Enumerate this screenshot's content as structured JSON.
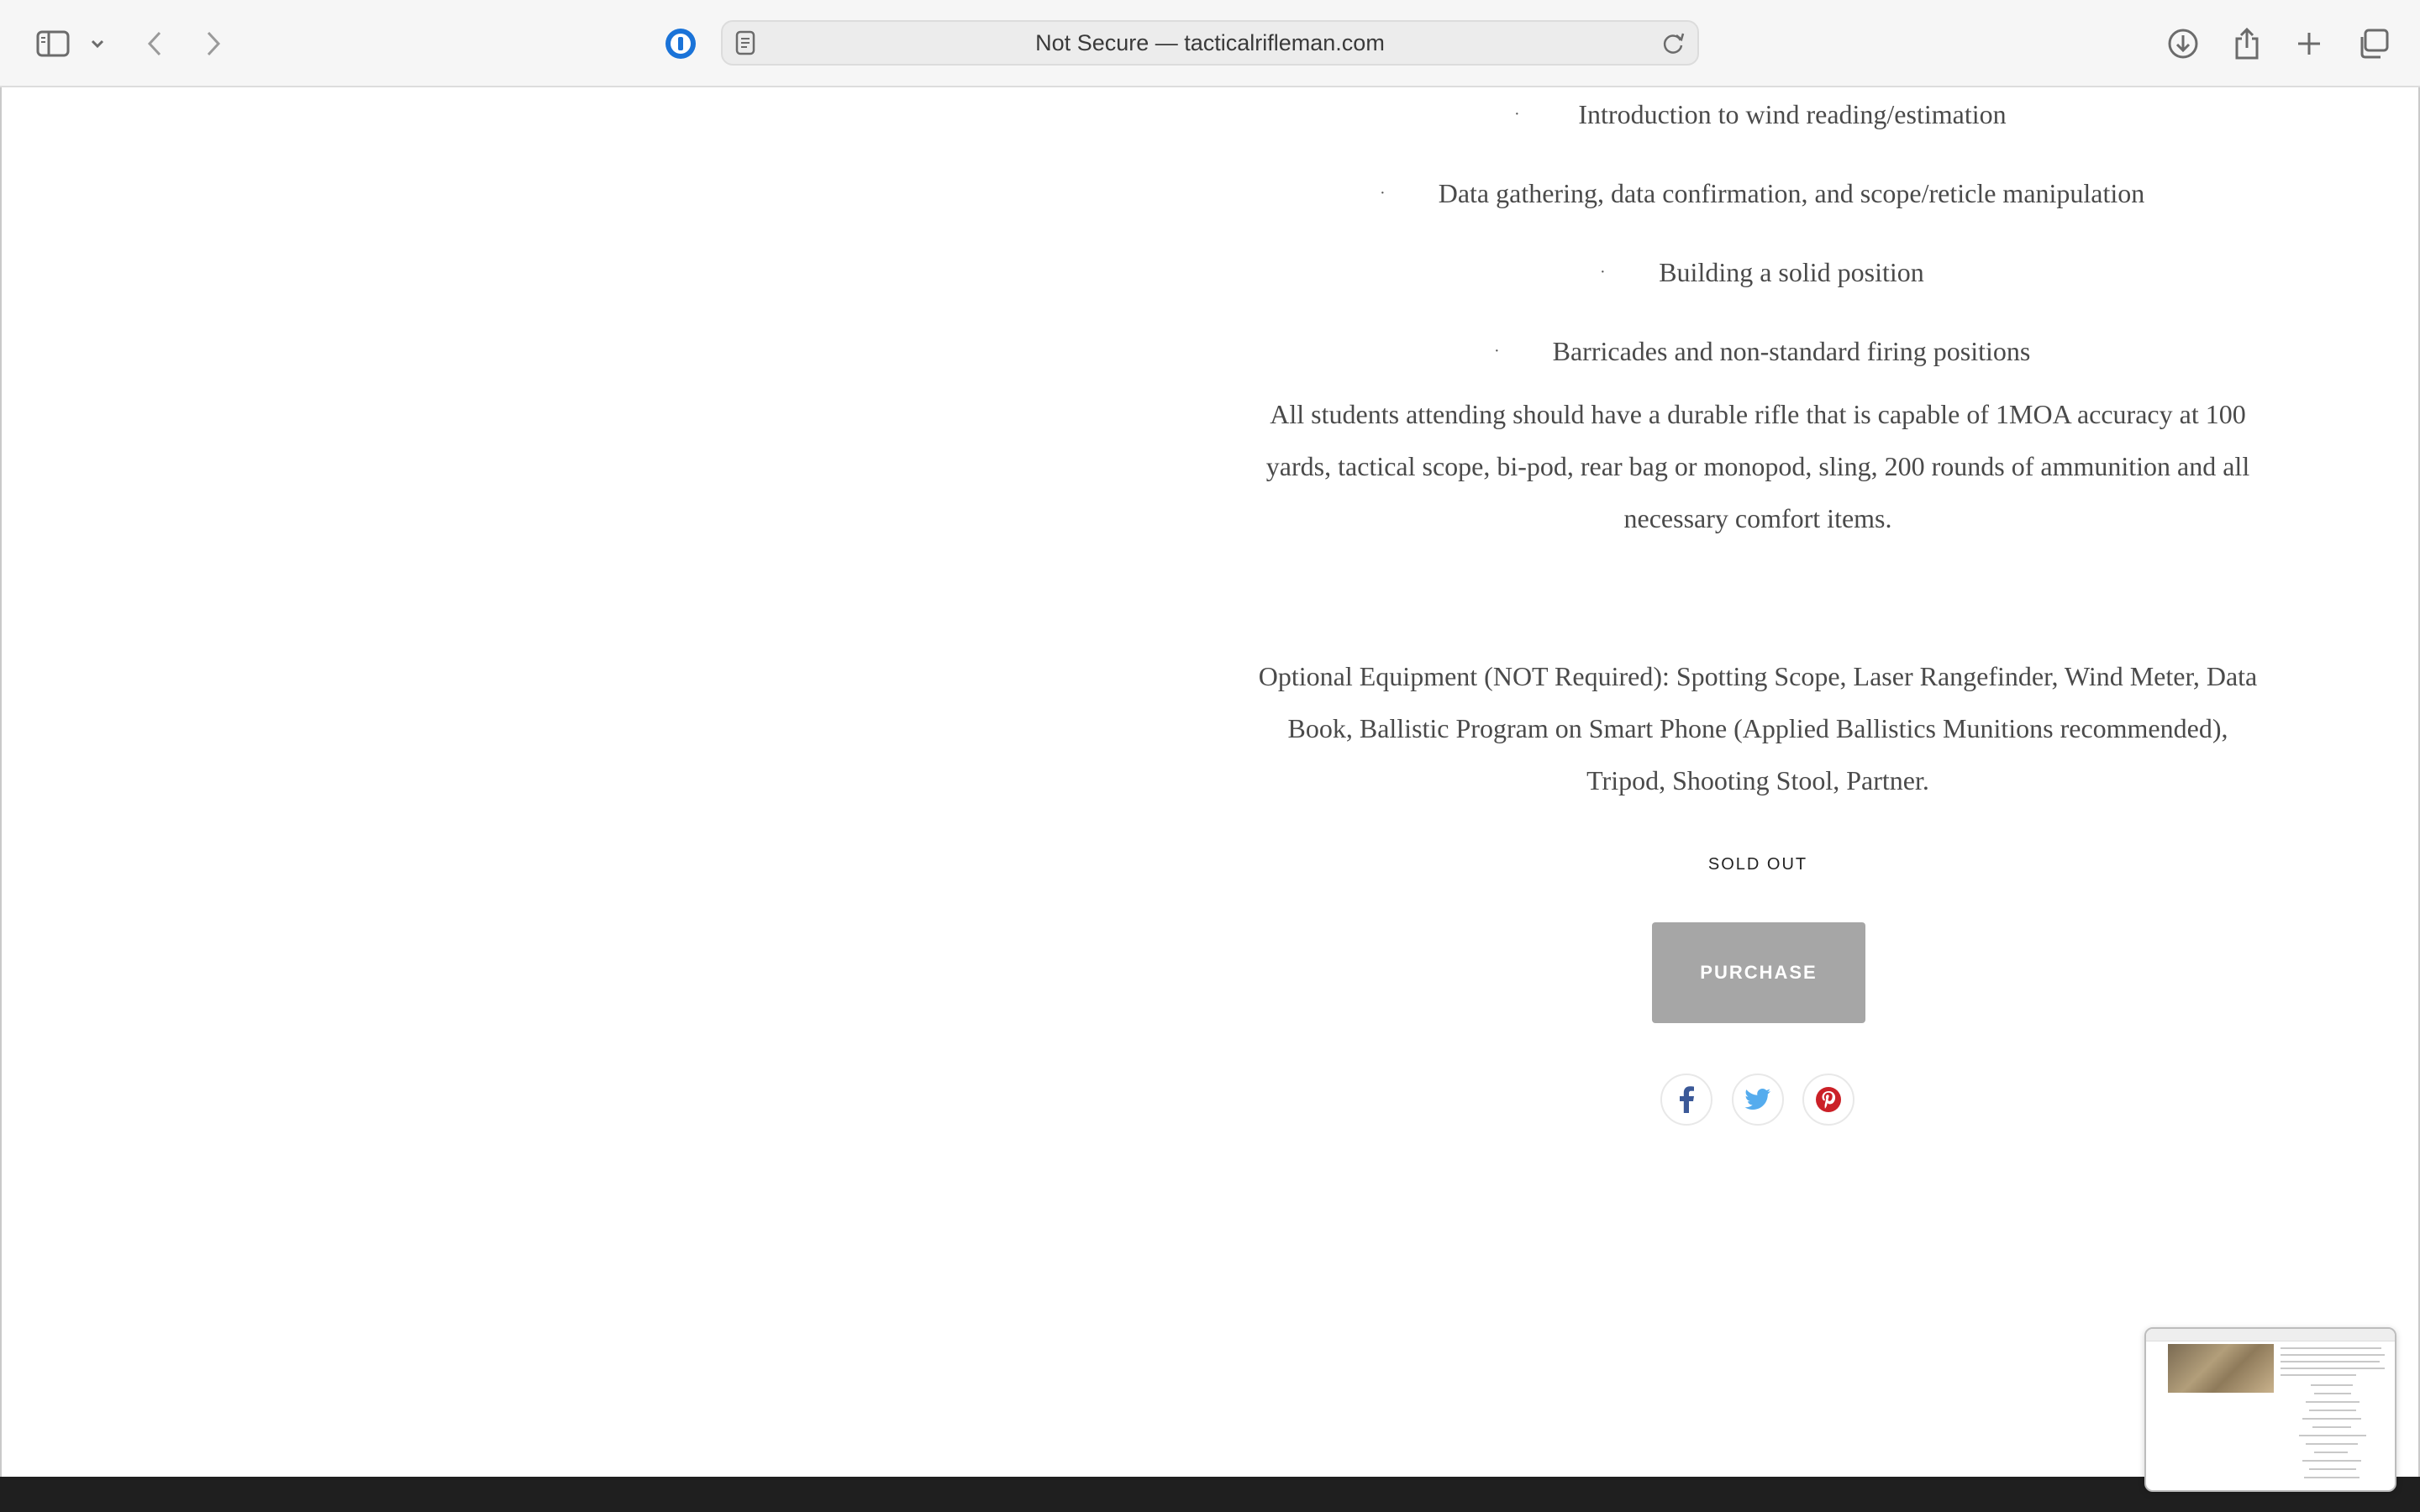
{
  "browser": {
    "url_text": "Not Secure — tacticalrifleman.com",
    "icons": {
      "sidebar": "sidebar-icon",
      "tab_menu": "chevron-down-icon",
      "back": "chevron-left-icon",
      "forward": "chevron-right-icon",
      "password": "password-manager-icon",
      "reader": "reader-icon",
      "reload": "reload-icon",
      "downloads": "download-icon",
      "share": "share-icon",
      "new_tab": "plus-icon",
      "tabs": "tab-overview-icon"
    }
  },
  "content": {
    "bullets": [
      "Introduction to wind reading/estimation",
      "Data gathering, data confirmation, and scope/reticle manipulation",
      "Building a solid position",
      "Barricades and non-standard firing positions"
    ],
    "bullet_marker": "·",
    "requirements": "All students attending should have a durable rifle that is capable of 1MOA accuracy at 100 yards, tactical scope, bi-pod, rear bag or monopod, sling, 200 rounds of ammunition and all necessary comfort items.",
    "optional_equipment": "Optional Equipment (NOT Required): Spotting Scope, Laser Rangefinder, Wind Meter, Data Book, Ballistic Program on Smart Phone (Applied Ballistics Munitions recommended), Tripod, Shooting Stool, Partner.",
    "status": "SOLD OUT",
    "purchase_label": "PURCHASE"
  },
  "share": {
    "facebook": {
      "icon": "facebook-icon",
      "color": "#3b5998"
    },
    "twitter": {
      "icon": "twitter-icon",
      "color": "#55acee"
    },
    "pinterest": {
      "icon": "pinterest-icon",
      "color": "#cb2027"
    }
  },
  "colors": {
    "button_gray": "#a6a6a6",
    "text_gray": "#4a4a4a",
    "footer": "#1f1f1f"
  }
}
